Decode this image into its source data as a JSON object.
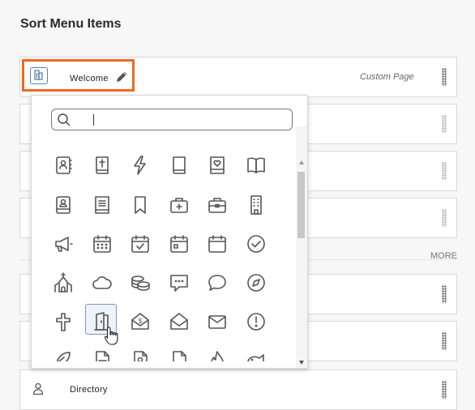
{
  "page": {
    "title": "Sort Menu Items"
  },
  "welcome_row": {
    "label": "Welcome",
    "type_text": "Custom Page",
    "icon": "building-icon",
    "edit_icon": "pencil-icon"
  },
  "more_label": "MORE",
  "directory_row": {
    "label": "Directory",
    "icon": "person-icon"
  },
  "icon_picker": {
    "search_placeholder": "",
    "search_value": "",
    "icons": [
      "contacts-book-icon",
      "bible-icon",
      "lightning-icon",
      "book-icon",
      "heart-book-icon",
      "open-book-icon",
      "profile-book-icon",
      "newspaper-icon",
      "bookmark-icon",
      "first-aid-kit-icon",
      "briefcase-icon",
      "office-building-icon",
      "megaphone-icon",
      "calendar-grid-icon",
      "calendar-check-icon",
      "calendar-day-icon",
      "calendar-icon",
      "check-circle-icon",
      "church-icon",
      "cloud-icon",
      "coins-icon",
      "chat-dots-icon",
      "speech-bubble-icon",
      "compass-icon",
      "cross-icon",
      "door-icon",
      "donation-envelope-icon",
      "open-envelope-icon",
      "envelope-icon",
      "exclamation-circle-icon",
      "feather-icon",
      "document-icon",
      "id-card-icon",
      "file-icon",
      "flame-icon",
      "fish-icon"
    ],
    "selected_icon": "door-icon"
  }
}
